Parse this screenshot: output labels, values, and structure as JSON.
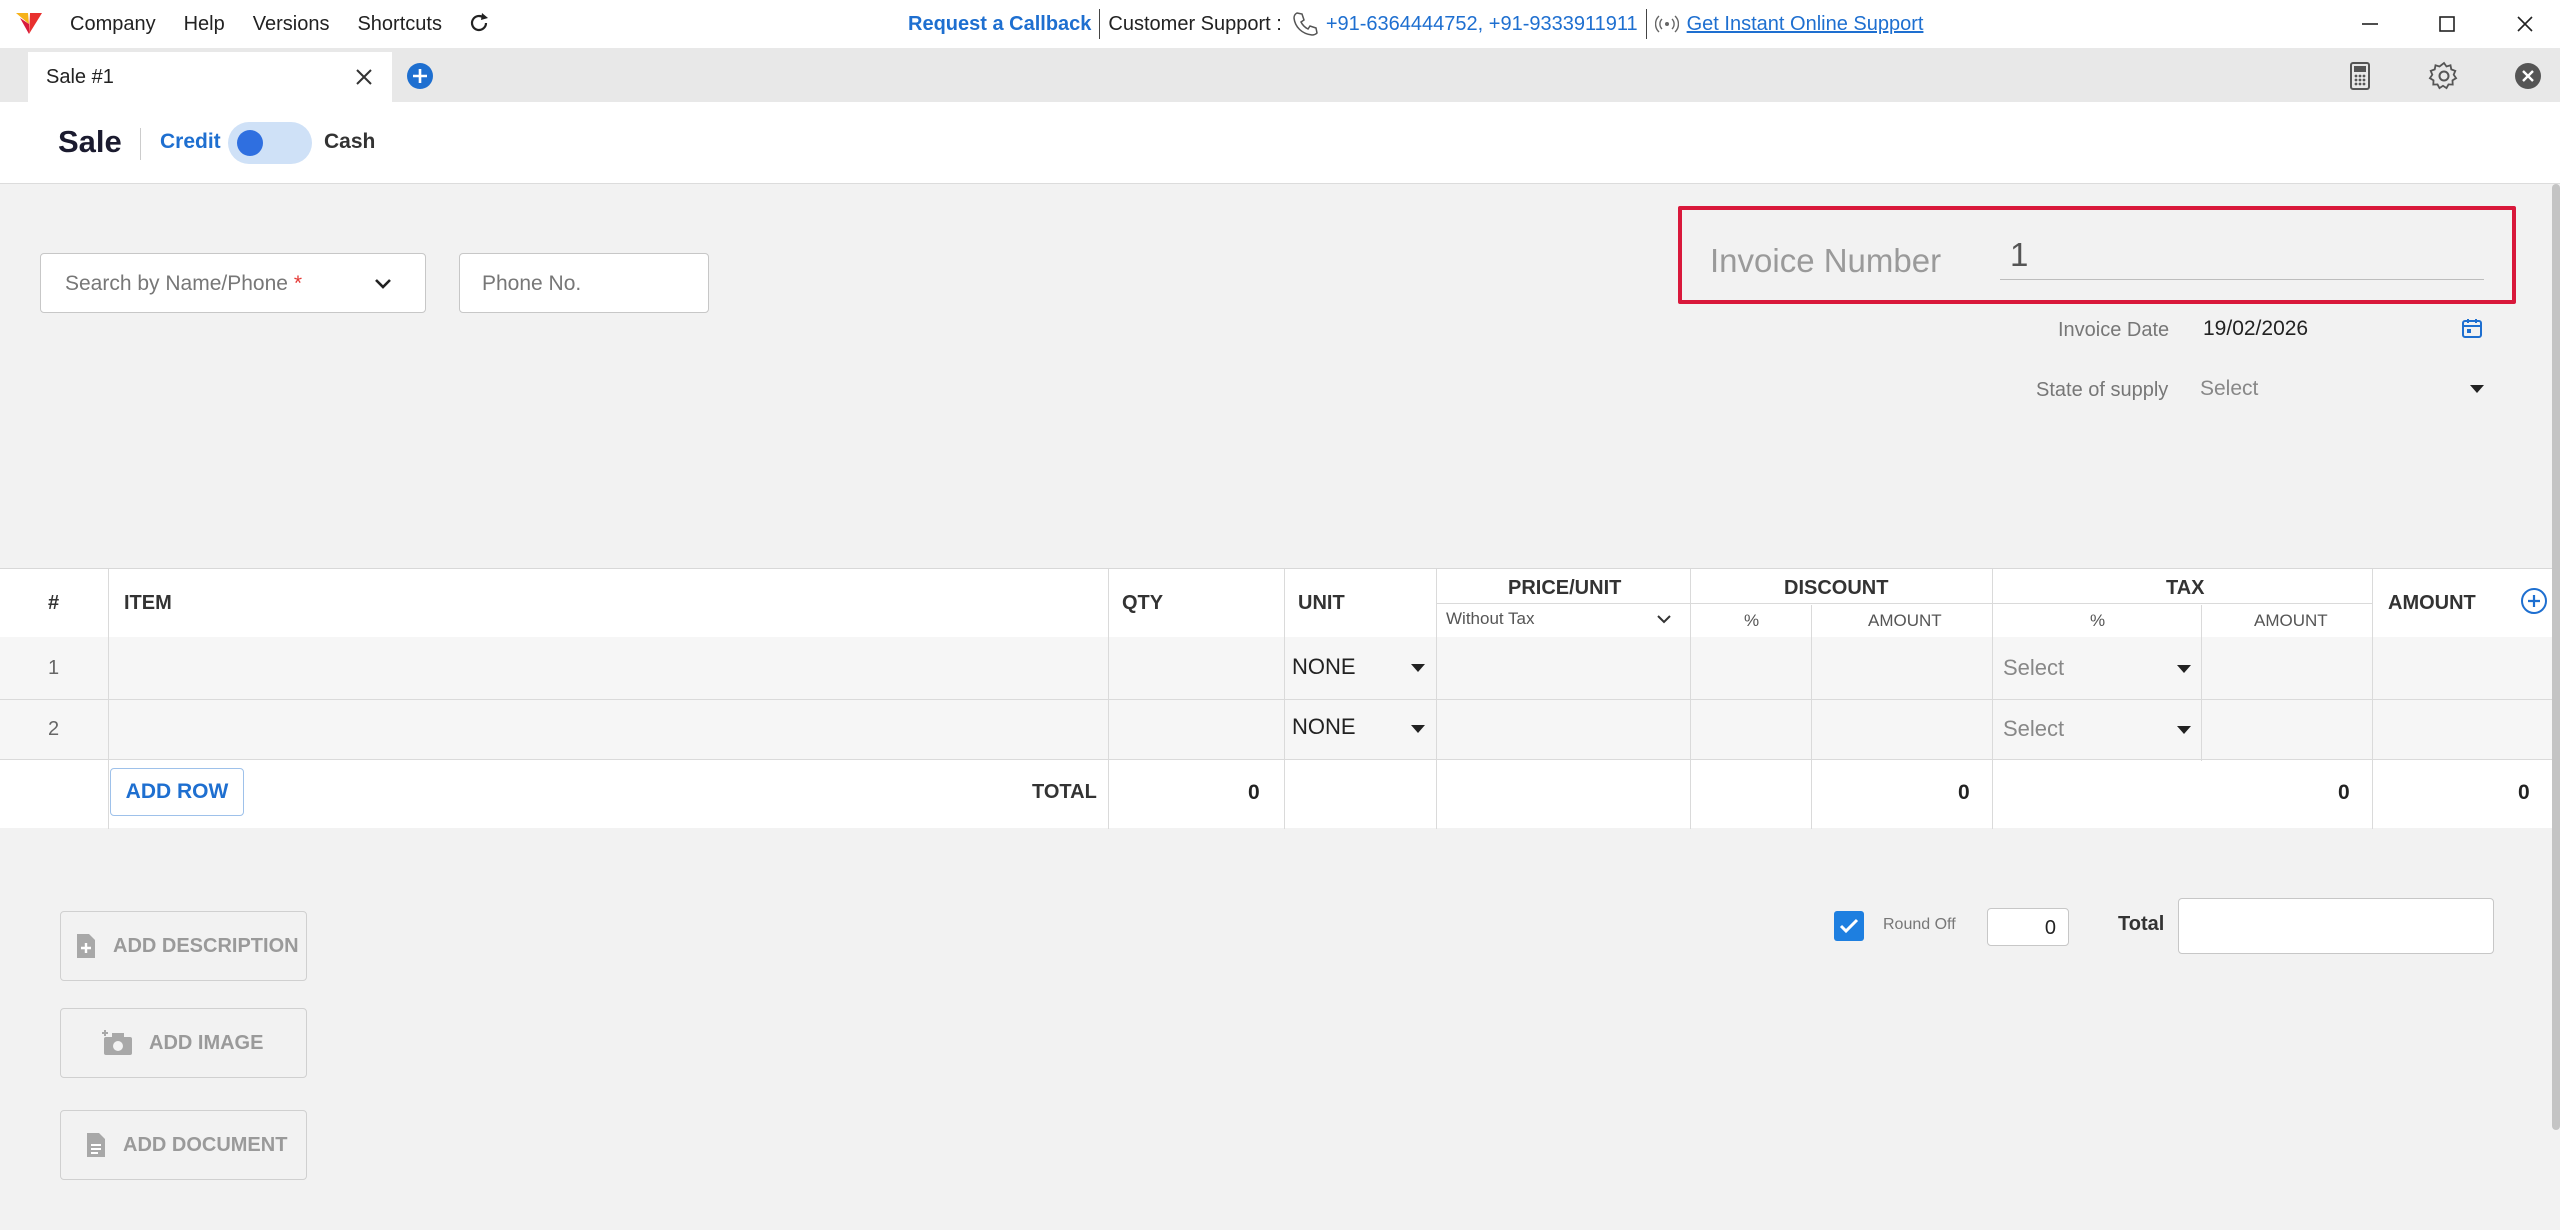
{
  "titlebar": {
    "menu": [
      "Company",
      "Help",
      "Versions",
      "Shortcuts"
    ],
    "callback": "Request a Callback",
    "support_label": "Customer Support :",
    "phones": "+91-6364444752, +91-9333911911",
    "online_support": "Get Instant Online Support"
  },
  "tabs": [
    {
      "label": "Sale #1"
    }
  ],
  "header": {
    "title": "Sale",
    "credit": "Credit",
    "cash": "Cash",
    "payment_mode": "credit"
  },
  "party": {
    "search_placeholder": "Search by Name/Phone",
    "required_mark": "*",
    "phone_placeholder": "Phone No."
  },
  "invoice": {
    "number_label": "Invoice Number",
    "number_value": "1",
    "date_label": "Invoice Date",
    "date_value": "19/02/2026",
    "state_label": "State of supply",
    "state_value": "Select"
  },
  "table": {
    "headers": {
      "num": "#",
      "item": "ITEM",
      "qty": "QTY",
      "unit": "UNIT",
      "price": "PRICE/UNIT",
      "price_sub": "Without Tax",
      "discount": "DISCOUNT",
      "discount_pct": "%",
      "discount_amt": "AMOUNT",
      "tax": "TAX",
      "tax_pct": "%",
      "tax_amt": "AMOUNT",
      "amount": "AMOUNT"
    },
    "rows": [
      {
        "num": "1",
        "unit": "NONE",
        "tax": "Select"
      },
      {
        "num": "2",
        "unit": "NONE",
        "tax": "Select"
      }
    ],
    "add_row": "ADD ROW",
    "total_label": "TOTAL",
    "totals": {
      "qty": "0",
      "discount": "0",
      "tax": "0",
      "amount": "0"
    }
  },
  "bottom": {
    "add_description": "ADD DESCRIPTION",
    "add_image": "ADD IMAGE",
    "add_document": "ADD DOCUMENT",
    "round_off_label": "Round Off",
    "round_off_value": "0",
    "round_off_checked": true,
    "total_label": "Total",
    "total_value": ""
  },
  "colors": {
    "accent": "#1e6fd0",
    "highlight": "#d9183b",
    "toggle_track": "#cfe1f7",
    "toggle_knob": "#2f6fe0"
  }
}
